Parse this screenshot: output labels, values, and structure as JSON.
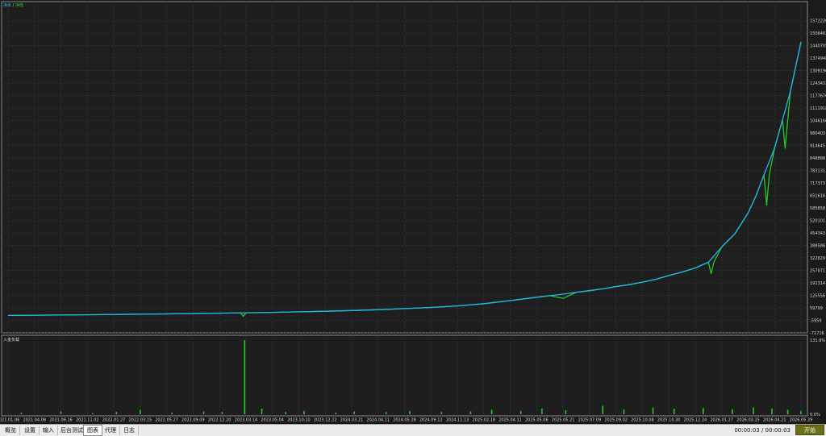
{
  "legend": {
    "balance_label": "净余",
    "separator": "/",
    "equity_label": "净值",
    "balance_color": "#1fb6ee",
    "equity_color": "#22cc22"
  },
  "sub_chart_label": "入金负载",
  "tabs": [
    {
      "label": "概览",
      "active": false
    },
    {
      "label": "设置",
      "active": false
    },
    {
      "label": "输入",
      "active": false
    },
    {
      "label": "后台测试",
      "active": false
    },
    {
      "label": "图表",
      "active": true
    },
    {
      "label": "代理",
      "active": false
    },
    {
      "label": "日志",
      "active": false
    }
  ],
  "timer": "00:00:03 / 00:00:03",
  "start_button": "开始",
  "chart_data": [
    {
      "type": "line",
      "title": "",
      "y_ticks": [
        1572220,
        1506462,
        1440705,
        1374948,
        1309190,
        1243433,
        1177676,
        1111918,
        1046160,
        980403,
        914645,
        848888,
        783131,
        717373,
        651616,
        585858,
        520101,
        454343,
        388586,
        322829,
        257071,
        191314,
        125556,
        59799,
        -5959,
        -71716
      ],
      "y_tick_labels": [
        "1572220",
        "1506462",
        "1440705",
        "1374948",
        "1309190",
        "1243433",
        "1177676",
        "1111918",
        "1046160",
        "980403",
        "914645",
        "848888",
        "783131",
        "717373",
        "651616",
        "585858",
        "520101",
        "454343",
        "388586",
        "322829",
        "257071",
        "191314",
        "125556",
        "59799",
        "-5959",
        "-71716"
      ],
      "ylim": [
        -71716,
        1638000
      ],
      "grid": true,
      "legend_position": "top-left",
      "x_labels": [
        "2021.01.06",
        "2021.04.08",
        "2021.06.16",
        "2021.11.02",
        "2022.01.27",
        "2022.03.15",
        "2022.05.27",
        "2022.09.09",
        "2022.12.20",
        "2023.03.14",
        "2023.05.04",
        "2023.10.10",
        "2023.12.22",
        "2024.03.21",
        "2024.04.11",
        "2024.05.28",
        "2024.09.12",
        "2024.11.13",
        "2025.02.18",
        "2025.04.11",
        "2025.05.06",
        "2025.05.21",
        "2025.07.09",
        "2025.09.02",
        "2025.10.08",
        "2025.10.30",
        "2025.12.24",
        "2026.01.27",
        "2026.03.25",
        "2026.04.21",
        "2026.05.29"
      ],
      "series": [
        {
          "name": "净余",
          "color": "#1fb6ee",
          "x": [
            0,
            2,
            4,
            6,
            8,
            10,
            12,
            13,
            14,
            15,
            16,
            17,
            18,
            19,
            20,
            20.5,
            21,
            21.5,
            22,
            22.5,
            23,
            23.5,
            24,
            24.5,
            25,
            25.5,
            26,
            26.5,
            27,
            27.5,
            28,
            28.3,
            28.6,
            29,
            29.3,
            29.6,
            30
          ],
          "y": [
            20000,
            22000,
            25000,
            28000,
            32000,
            36000,
            42000,
            46000,
            50000,
            56000,
            62000,
            70000,
            82000,
            98000,
            116000,
            124000,
            132000,
            142000,
            150000,
            160000,
            172000,
            182000,
            195000,
            210000,
            230000,
            248000,
            270000,
            300000,
            380000,
            450000,
            560000,
            650000,
            760000,
            900000,
            1050000,
            1200000,
            1460000
          ]
        },
        {
          "name": "净值",
          "color": "#22cc22",
          "x": [
            0,
            2,
            4,
            6,
            8,
            8.8,
            8.9,
            9,
            10,
            12,
            13,
            14,
            15,
            16,
            17,
            18,
            19,
            20,
            20.5,
            21,
            21.5,
            22,
            22.5,
            23,
            23.5,
            24,
            24.5,
            25,
            25.5,
            26,
            26.5,
            26.6,
            26.7,
            27,
            27.5,
            28,
            28.3,
            28.6,
            28.7,
            28.8,
            29,
            29.3,
            29.4,
            29.5,
            29.6,
            30
          ],
          "y": [
            20000,
            22000,
            25000,
            28000,
            32000,
            34000,
            15000,
            34000,
            36000,
            42000,
            46000,
            50000,
            56000,
            62000,
            70000,
            82000,
            98000,
            116000,
            124000,
            110000,
            142000,
            150000,
            160000,
            172000,
            182000,
            195000,
            210000,
            230000,
            248000,
            270000,
            300000,
            240000,
            300000,
            380000,
            450000,
            560000,
            650000,
            760000,
            600000,
            760000,
            900000,
            1050000,
            900000,
            1050000,
            1200000,
            1460000
          ]
        }
      ]
    },
    {
      "type": "bar",
      "title": "入金负载",
      "y_tick_labels": [
        "131.9%",
        "0.0%"
      ],
      "ylim": [
        0,
        131.9
      ],
      "grid": true,
      "series": [
        {
          "name": "入金负载",
          "color": "#22cc22",
          "x": [
            0.5,
            2,
            3.2,
            4.1,
            5,
            6.2,
            7.4,
            8.1,
            8.95,
            9.6,
            10.5,
            11.2,
            12.4,
            13.1,
            14.3,
            15.2,
            16.4,
            17.5,
            18.3,
            19.4,
            20.2,
            21.1,
            22.5,
            23.3,
            24.4,
            25.2,
            26.3,
            27.4,
            28.2,
            28.9,
            29.5,
            30
          ],
          "values": [
            3,
            5,
            2,
            4,
            8,
            3,
            5,
            4,
            131.9,
            10,
            4,
            6,
            3,
            5,
            4,
            6,
            4,
            5,
            8,
            6,
            10,
            7,
            15,
            9,
            12,
            10,
            11,
            9,
            12,
            10,
            8,
            6
          ]
        }
      ]
    }
  ]
}
